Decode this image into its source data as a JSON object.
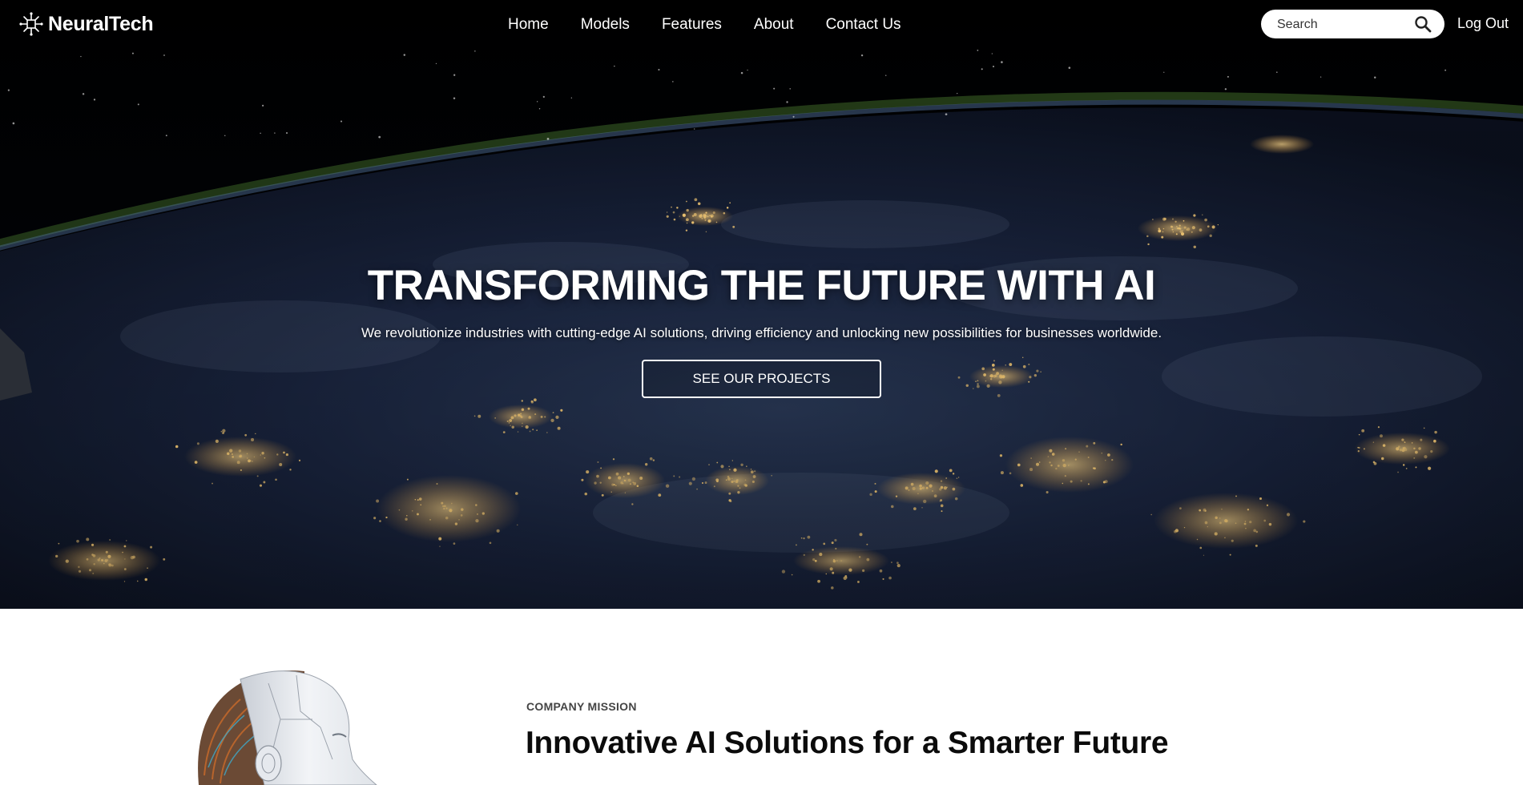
{
  "brand": {
    "name": "NeuralTech",
    "icon": "neural-chip-icon"
  },
  "nav": {
    "links": [
      {
        "label": "Home"
      },
      {
        "label": "Models"
      },
      {
        "label": "Features"
      },
      {
        "label": "About"
      },
      {
        "label": "Contact Us"
      }
    ],
    "search": {
      "placeholder": "Search",
      "value": "",
      "icon": "search-icon"
    },
    "logout_label": "Log Out"
  },
  "hero": {
    "title": "TRANSFORMING THE FUTURE WITH AI",
    "subtitle": "We revolutionize industries with cutting-edge AI solutions, driving efficiency and unlocking new possibilities for businesses worldwide.",
    "cta_label": "SEE OUR PROJECTS",
    "background": "earth-at-night-from-space-image"
  },
  "mission": {
    "eyebrow": "COMPANY MISSION",
    "heading": "Innovative AI Solutions for a Smarter Future",
    "image": "robot-head-image"
  },
  "colors": {
    "nav_text": "#ffffff",
    "hero_bg": "#02040a",
    "city_lights": "#ffc96b",
    "page_bg": "#ffffff",
    "heading_text": "#0b0b0b"
  }
}
